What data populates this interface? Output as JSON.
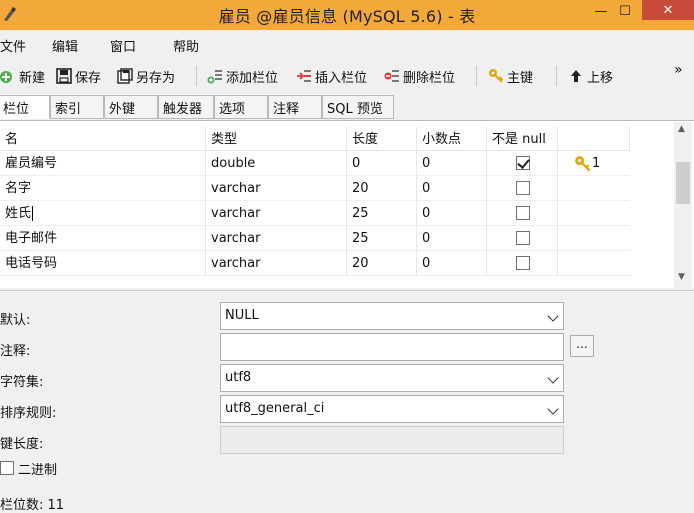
{
  "window": {
    "title": "雇员 @雇员信息 (MySQL 5.6) - 表",
    "min_glyph": "—",
    "max_glyph": "☐",
    "close_glyph": "✕"
  },
  "menu": [
    "文件",
    "编辑",
    "窗口",
    "帮助"
  ],
  "toolbar": {
    "new": "新建",
    "save": "保存",
    "save_as": "另存为",
    "add_field": "添加栏位",
    "insert_field": "插入栏位",
    "delete_field": "删除栏位",
    "primary_key": "主键",
    "move_up": "上移",
    "more": "»"
  },
  "tabs": [
    "栏位",
    "索引",
    "外键",
    "触发器",
    "选项",
    "注释",
    "SQL 预览"
  ],
  "grid": {
    "headers": [
      "名",
      "类型",
      "长度",
      "小数点",
      "不是 null"
    ],
    "rows": [
      {
        "name": "雇员编号",
        "type": "double",
        "length": "0",
        "decimals": "0",
        "not_null": true,
        "key": "1"
      },
      {
        "name": "名字",
        "type": "varchar",
        "length": "20",
        "decimals": "0",
        "not_null": false,
        "key": ""
      },
      {
        "name": "姓氏",
        "type": "varchar",
        "length": "25",
        "decimals": "0",
        "not_null": false,
        "key": ""
      },
      {
        "name": "电子邮件",
        "type": "varchar",
        "length": "25",
        "decimals": "0",
        "not_null": false,
        "key": ""
      },
      {
        "name": "电话号码",
        "type": "varchar",
        "length": "20",
        "decimals": "0",
        "not_null": false,
        "key": ""
      }
    ]
  },
  "props": {
    "default_label": "默认:",
    "default_value": "NULL",
    "comment_label": "注释:",
    "comment_value": "",
    "comment_button": "...",
    "charset_label": "字符集:",
    "charset_value": "utf8",
    "collation_label": "排序规则:",
    "collation_value": "utf8_general_ci",
    "key_length_label": "键长度:",
    "key_length_value": "",
    "binary_label": "二进制"
  },
  "status": {
    "field_count": "栏位数: 11"
  },
  "colors": {
    "titlebar": "#f3a93a",
    "close": "#c74a3a",
    "key_icon": "#e0a800"
  }
}
